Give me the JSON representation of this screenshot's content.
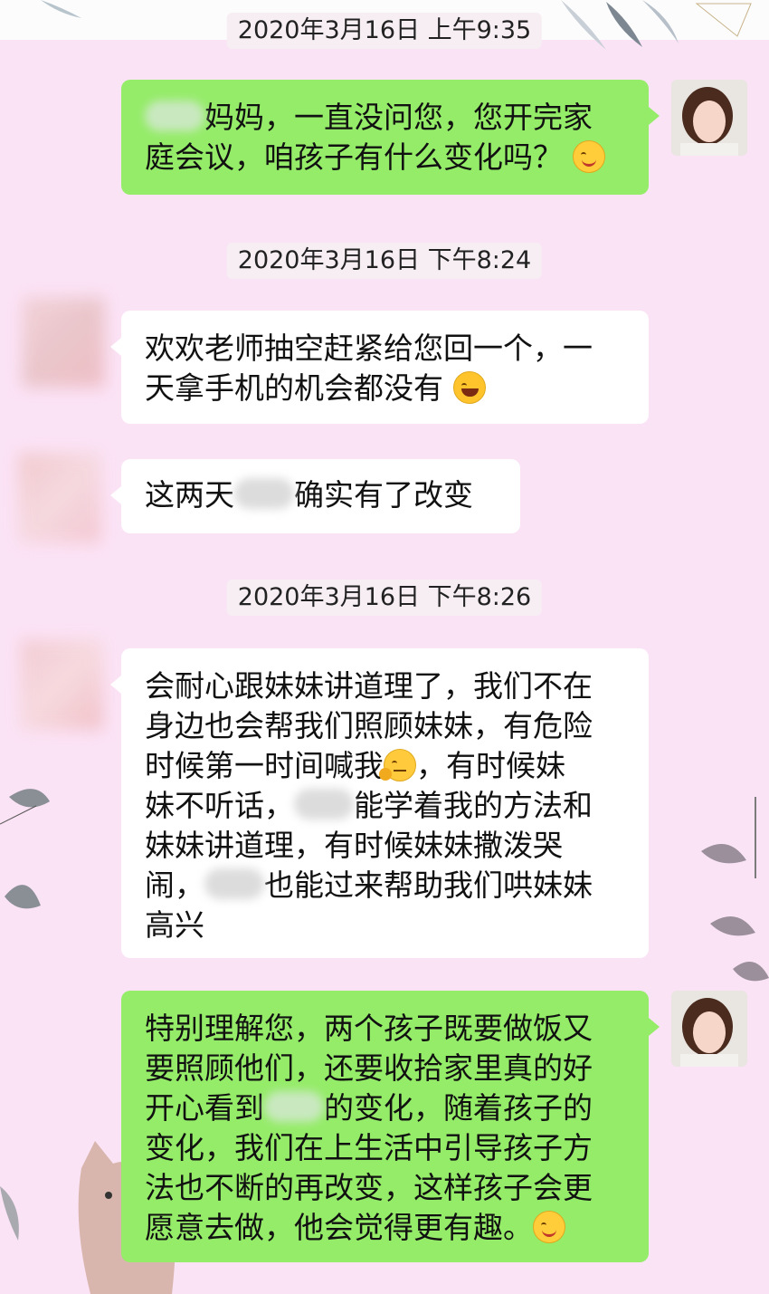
{
  "timestamps": [
    "2020年3月16日 上午9:35",
    "2020年3月16日 下午8:24",
    "2020年3月16日 下午8:26"
  ],
  "messages": [
    {
      "side": "right",
      "lines": [
        "妈妈，一直没问您，您开完家",
        "庭会议，咱孩子有什么变化吗？"
      ]
    },
    {
      "side": "left",
      "lines": [
        "欢欢老师抽空赶紧给您回一个，一",
        "天拿手机的机会都没有"
      ]
    },
    {
      "side": "left",
      "lines": [
        "这两天",
        "确实有了改变"
      ]
    },
    {
      "side": "left",
      "lines": [
        "会耐心跟妹妹讲道理了，我们不在",
        "身边也会帮我们照顾妹妹，有危险",
        "时候第一时间喊我",
        "，有时候妹",
        "妹不听话，",
        "能学着我的方法和",
        "妹妹讲道理，有时候妹妹撒泼哭",
        "闹，",
        "也能过来帮助我们哄妹妹",
        "高兴"
      ]
    },
    {
      "side": "right",
      "lines": [
        "特别理解您，两个孩子既要做饭又",
        "要照顾他们，还要收拾家里真的好",
        "开心看到",
        "的变化，随着孩子的",
        "变化，我们在上生活中引导孩子方",
        "法也不断的再改变，这样孩子会更",
        "愿意去做，他会觉得更有趣。"
      ]
    }
  ],
  "icons": {
    "smile": "smiling-face-emoji",
    "laugh": "tears-of-joy-emoji",
    "think": "thinking-face-emoji"
  },
  "colors": {
    "background": "#fbe3f6",
    "sent_bubble": "#95ec69",
    "received_bubble": "#ffffff",
    "timestamp_bg": "#f6eef3"
  }
}
